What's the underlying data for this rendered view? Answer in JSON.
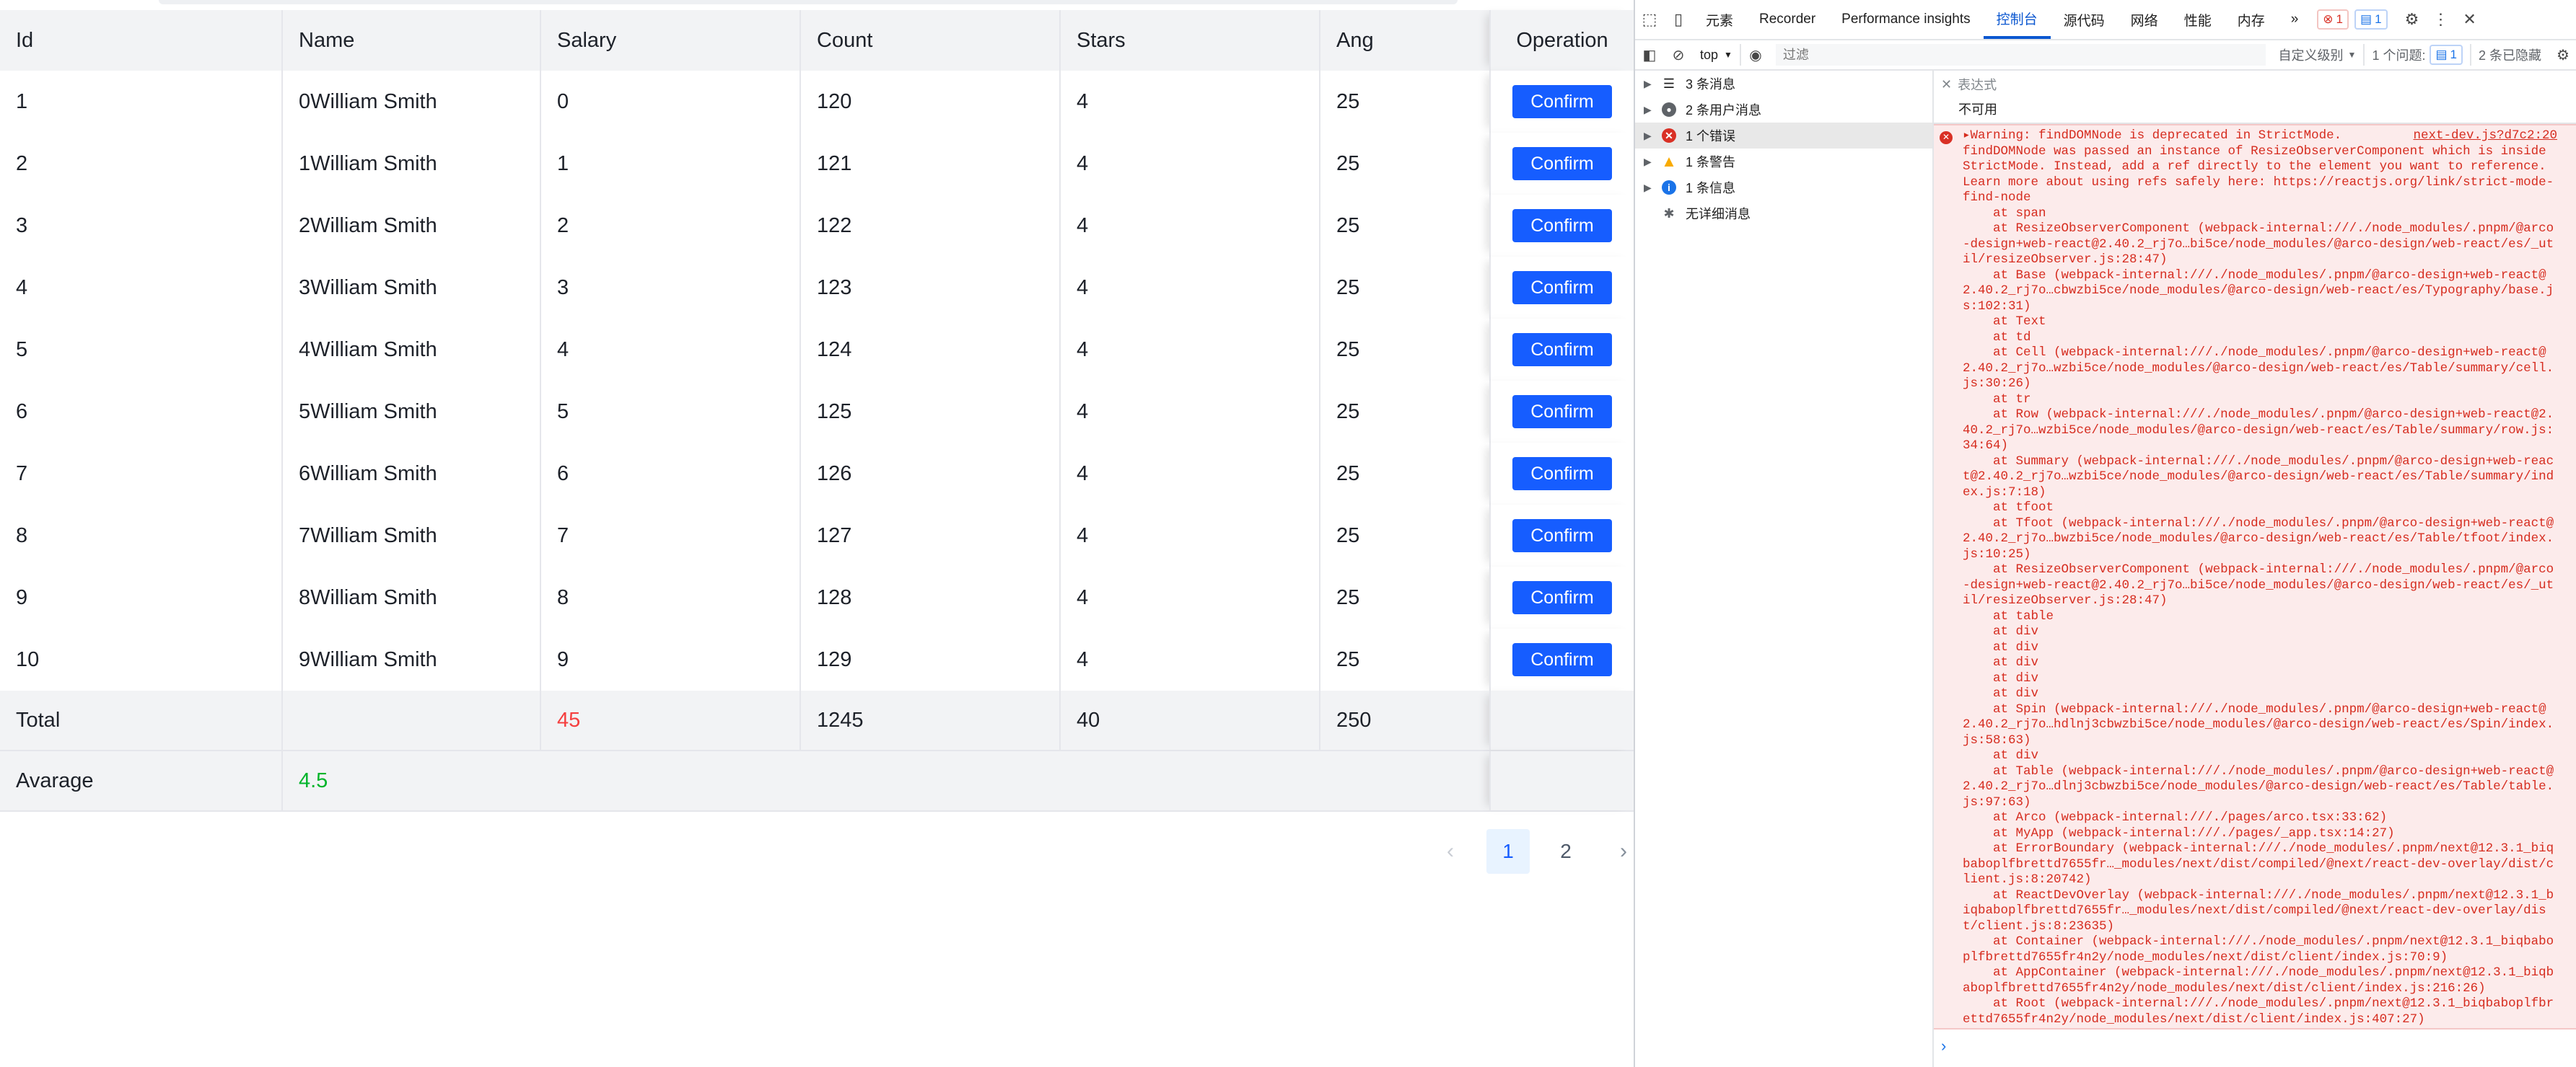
{
  "table": {
    "columns": [
      "Id",
      "Name",
      "Salary",
      "Count",
      "Stars",
      "Ang",
      "Operation"
    ],
    "rows": [
      {
        "id": "1",
        "name": "0William Smith",
        "salary": "0",
        "count": "120",
        "stars": "4",
        "ang": "25",
        "op": "Confirm"
      },
      {
        "id": "2",
        "name": "1William Smith",
        "salary": "1",
        "count": "121",
        "stars": "4",
        "ang": "25",
        "op": "Confirm"
      },
      {
        "id": "3",
        "name": "2William Smith",
        "salary": "2",
        "count": "122",
        "stars": "4",
        "ang": "25",
        "op": "Confirm"
      },
      {
        "id": "4",
        "name": "3William Smith",
        "salary": "3",
        "count": "123",
        "stars": "4",
        "ang": "25",
        "op": "Confirm"
      },
      {
        "id": "5",
        "name": "4William Smith",
        "salary": "4",
        "count": "124",
        "stars": "4",
        "ang": "25",
        "op": "Confirm"
      },
      {
        "id": "6",
        "name": "5William Smith",
        "salary": "5",
        "count": "125",
        "stars": "4",
        "ang": "25",
        "op": "Confirm"
      },
      {
        "id": "7",
        "name": "6William Smith",
        "salary": "6",
        "count": "126",
        "stars": "4",
        "ang": "25",
        "op": "Confirm"
      },
      {
        "id": "8",
        "name": "7William Smith",
        "salary": "7",
        "count": "127",
        "stars": "4",
        "ang": "25",
        "op": "Confirm"
      },
      {
        "id": "9",
        "name": "8William Smith",
        "salary": "8",
        "count": "128",
        "stars": "4",
        "ang": "25",
        "op": "Confirm"
      },
      {
        "id": "10",
        "name": "9William Smith",
        "salary": "9",
        "count": "129",
        "stars": "4",
        "ang": "25",
        "op": "Confirm"
      }
    ],
    "summary_total": {
      "label": "Total",
      "salary": "45",
      "count": "1245",
      "stars": "40",
      "ang": "250"
    },
    "summary_average": {
      "label": "Avarage",
      "name": "4.5"
    }
  },
  "pagination": {
    "prev": "‹",
    "pages": [
      "1",
      "2"
    ],
    "current": "1",
    "next": "›"
  },
  "devtools": {
    "tabs": [
      "元素",
      "Recorder",
      "Performance insights",
      "控制台",
      "源代码",
      "网络",
      "性能",
      "内存"
    ],
    "active_tab": "控制台",
    "more_tabs": "»",
    "error_badge": "1",
    "message_badge": "1",
    "toolbar": {
      "context": "top",
      "filter_placeholder": "过滤",
      "levels": "自定义级别",
      "issues_label": "1 个问题:",
      "issues_count": "1",
      "hidden": "2 条已隐藏"
    },
    "sidebar": [
      {
        "label": "3 条消息",
        "icon": "list-icon"
      },
      {
        "label": "2 条用户消息",
        "icon": "user-icon"
      },
      {
        "label": "1 个错误",
        "icon": "error-icon"
      },
      {
        "label": "1 条警告",
        "icon": "warning-icon"
      },
      {
        "label": "1 条信息",
        "icon": "info-icon"
      },
      {
        "label": "无详细消息",
        "icon": "bug-icon"
      }
    ],
    "expression": {
      "label": "表达式",
      "value": "不可用"
    },
    "error": {
      "source": "next-dev.js?d7c2:20",
      "lines": [
        "▸Warning: findDOMNode is deprecated in StrictMode.",
        "findDOMNode was passed an instance of ResizeObserverComponent which is inside StrictMode. Instead, add a ref directly to the element you want to reference. Learn more about using refs safely here: https://reactjs.org/link/strict-mode-find-node",
        "    at span",
        "    at ResizeObserverComponent (webpack-internal:///./node_modules/.pnpm/@arco-design+web-react@2.40.2_rj7o…bi5ce/node_modules/@arco-design/web-react/es/_util/resizeObserver.js:28:47)",
        "    at Base (webpack-internal:///./node_modules/.pnpm/@arco-design+web-react@2.40.2_rj7o…cbwzbi5ce/node_modules/@arco-design/web-react/es/Typography/base.js:102:31)",
        "    at Text",
        "    at td",
        "    at Cell (webpack-internal:///./node_modules/.pnpm/@arco-design+web-react@2.40.2_rj7o…wzbi5ce/node_modules/@arco-design/web-react/es/Table/summary/cell.js:30:26)",
        "    at tr",
        "    at Row (webpack-internal:///./node_modules/.pnpm/@arco-design+web-react@2.40.2_rj7o…wzbi5ce/node_modules/@arco-design/web-react/es/Table/summary/row.js:34:64)",
        "    at Summary (webpack-internal:///./node_modules/.pnpm/@arco-design+web-react@2.40.2_rj7o…wzbi5ce/node_modules/@arco-design/web-react/es/Table/summary/index.js:7:18)",
        "    at tfoot",
        "    at Tfoot (webpack-internal:///./node_modules/.pnpm/@arco-design+web-react@2.40.2_rj7o…bwzbi5ce/node_modules/@arco-design/web-react/es/Table/tfoot/index.js:10:25)",
        "    at ResizeObserverComponent (webpack-internal:///./node_modules/.pnpm/@arco-design+web-react@2.40.2_rj7o…bi5ce/node_modules/@arco-design/web-react/es/_util/resizeObserver.js:28:47)",
        "    at table",
        "    at div",
        "    at div",
        "    at div",
        "    at div",
        "    at div",
        "    at Spin (webpack-internal:///./node_modules/.pnpm/@arco-design+web-react@2.40.2_rj7o…hdlnj3cbwzbi5ce/node_modules/@arco-design/web-react/es/Spin/index.js:58:63)",
        "    at div",
        "    at Table (webpack-internal:///./node_modules/.pnpm/@arco-design+web-react@2.40.2_rj7o…dlnj3cbwzbi5ce/node_modules/@arco-design/web-react/es/Table/table.js:97:63)",
        "    at Arco (webpack-internal:///./pages/arco.tsx:33:62)",
        "    at MyApp (webpack-internal:///./pages/_app.tsx:14:27)",
        "    at ErrorBoundary (webpack-internal:///./node_modules/.pnpm/next@12.3.1_biqbaboplfbrettd7655fr…_modules/next/dist/compiled/@next/react-dev-overlay/dist/client.js:8:20742)",
        "    at ReactDevOverlay (webpack-internal:///./node_modules/.pnpm/next@12.3.1_biqbaboplfbrettd7655fr…_modules/next/dist/compiled/@next/react-dev-overlay/dist/client.js:8:23635)",
        "    at Container (webpack-internal:///./node_modules/.pnpm/next@12.3.1_biqbaboplfbrettd7655fr4n2y/node_modules/next/dist/client/index.js:70:9)",
        "    at AppContainer (webpack-internal:///./node_modules/.pnpm/next@12.3.1_biqbaboplfbrettd7655fr4n2y/node_modules/next/dist/client/index.js:216:26)",
        "    at Root (webpack-internal:///./node_modules/.pnpm/next@12.3.1_biqbaboplfbrettd7655fr4n2y/node_modules/next/dist/client/index.js:407:27)"
      ]
    },
    "prompt": "›"
  },
  "colors": {
    "primary": "#165dff",
    "danger": "#f53f3f",
    "success": "#00b42a",
    "error_bg": "#fcebeb"
  }
}
